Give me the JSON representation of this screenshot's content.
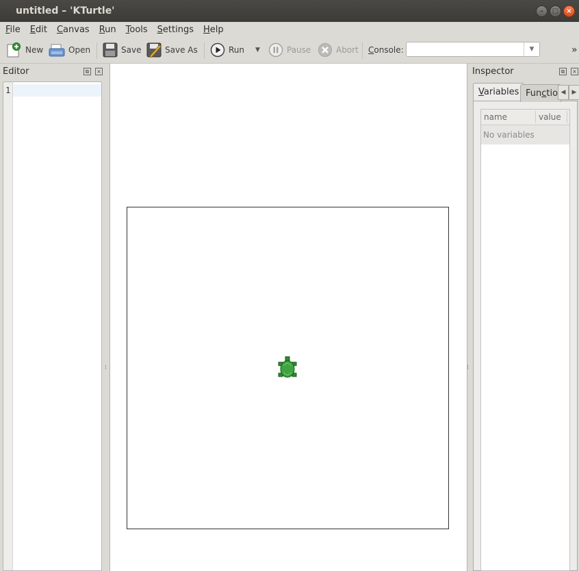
{
  "window": {
    "title": "untitled – 'KTurtle'"
  },
  "menubar": [
    {
      "acc": "F",
      "rest": "ile"
    },
    {
      "acc": "E",
      "rest": "dit"
    },
    {
      "acc": "C",
      "rest": "anvas"
    },
    {
      "acc": "R",
      "rest": "un"
    },
    {
      "acc": "T",
      "rest": "ools"
    },
    {
      "acc": "S",
      "rest": "ettings"
    },
    {
      "acc": "H",
      "rest": "elp"
    }
  ],
  "toolbar": {
    "new": "New",
    "open": "Open",
    "save": "Save",
    "save_as": "Save As",
    "run": "Run",
    "pause": "Pause",
    "abort": "Abort",
    "console_label": "Console:",
    "console_value": "",
    "overflow": "»"
  },
  "editor": {
    "title": "Editor",
    "line_numbers": [
      "1"
    ],
    "content": ""
  },
  "inspector": {
    "title": "Inspector",
    "tabs": [
      {
        "acc": "V",
        "rest": "ariables",
        "active": true
      },
      {
        "acc": "",
        "pre": "Fun",
        "acc2": "c",
        "rest": "tions",
        "shown": "Functio",
        "active": false
      }
    ],
    "variables": {
      "columns": [
        "name",
        "value"
      ],
      "empty_text": "No variables"
    }
  },
  "icons": {
    "turtle": "turtle-icon",
    "accent": "#df4a16",
    "turtle_color": "#3a9a3a"
  }
}
